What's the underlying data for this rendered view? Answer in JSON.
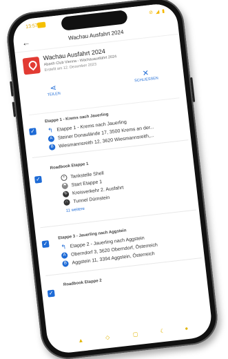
{
  "status": {
    "time": "13:57",
    "icons": "⊘ ◢ ▮"
  },
  "appbar": {
    "title": "Wachau Ausfahrt 2024"
  },
  "header": {
    "title": "Wachau Ausfahrt 2024",
    "org": "Abarth Club Vienna - Wachauausfahrt 2024",
    "created": "Erstellt am 12. Dezember 2023",
    "share_label": "TEILEN",
    "close_label": "SCHLIESSEN"
  },
  "sections": [
    {
      "title": "Etappe 1 - Krems nach Jauerling",
      "rows": [
        {
          "icon": "route-icon",
          "text": "Etappe 1 - Krems nach Jauerling"
        },
        {
          "icon": "start-marker-icon",
          "text": "Steiner Donaulände 17, 3500 Krems an der..."
        },
        {
          "icon": "end-marker-icon",
          "text": "Wiesmannsreith 12, 3620 Wiesmannsreith,..."
        }
      ]
    },
    {
      "title": "Roadbook Etappe 1",
      "rows": [
        {
          "icon": "gas-station-icon",
          "text": "Tankstelle Shell"
        },
        {
          "icon": "start-flag-icon",
          "text": "Start Etappe 1"
        },
        {
          "icon": "roundabout-icon",
          "text": "Kreisverkehr 2. Ausfahrt"
        },
        {
          "icon": "tunnel-icon",
          "text": "Tunnel Dürnstein"
        }
      ],
      "more": "11 weitere"
    },
    {
      "title": "Etappe 3 - Jauerling nach Aggstein",
      "rows": [
        {
          "icon": "route-icon",
          "text": "Etappe 2 - Jauerling nach Aggstein"
        },
        {
          "icon": "start-marker-icon",
          "text": "Oberndorf 3, 3620 Oberndorf, Österreich"
        },
        {
          "icon": "end-marker-icon",
          "text": "Aggstein 11, 3394 Aggstein, Österreich"
        }
      ]
    },
    {
      "title": "Roadbook Etappe 2",
      "rows": []
    }
  ],
  "colors": {
    "accent": "#1e6bd6",
    "pin": "#e23b33",
    "status": "#f5c000"
  }
}
